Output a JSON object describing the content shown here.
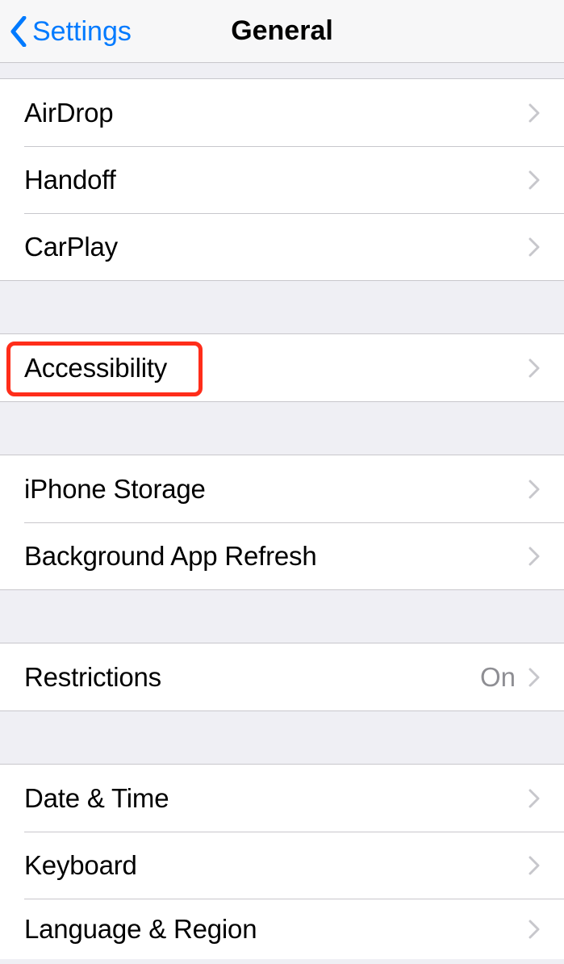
{
  "colors": {
    "accent": "#007AFF",
    "chevron": "#C7C7CC",
    "detail_text": "#8E8E93",
    "highlight": "#FF2D1A"
  },
  "navbar": {
    "back_label": "Settings",
    "title": "General"
  },
  "groups": [
    {
      "rows": [
        {
          "label": "AirDrop",
          "detail": ""
        },
        {
          "label": "Handoff",
          "detail": ""
        },
        {
          "label": "CarPlay",
          "detail": ""
        }
      ]
    },
    {
      "rows": [
        {
          "label": "Accessibility",
          "detail": ""
        }
      ]
    },
    {
      "rows": [
        {
          "label": "iPhone Storage",
          "detail": ""
        },
        {
          "label": "Background App Refresh",
          "detail": ""
        }
      ]
    },
    {
      "rows": [
        {
          "label": "Restrictions",
          "detail": "On"
        }
      ]
    },
    {
      "rows": [
        {
          "label": "Date & Time",
          "detail": ""
        },
        {
          "label": "Keyboard",
          "detail": ""
        },
        {
          "label": "Language & Region",
          "detail": ""
        }
      ]
    }
  ]
}
